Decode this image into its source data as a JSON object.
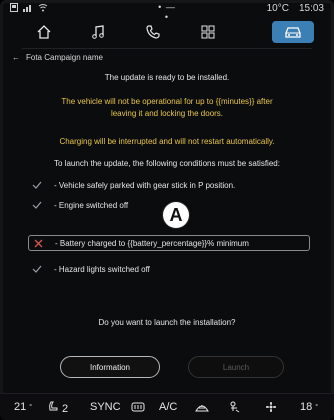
{
  "status_bar": {
    "left_icons": [
      "window-icon",
      "signal-icon",
      "wifi-icon"
    ],
    "center": "• — •",
    "temperature": "10°C",
    "time": "15:03"
  },
  "nav": {
    "items": [
      {
        "name": "home-icon"
      },
      {
        "name": "music-icon"
      },
      {
        "name": "phone-icon"
      },
      {
        "name": "apps-icon"
      },
      {
        "name": "car-icon",
        "active": true
      }
    ]
  },
  "breadcrumb": {
    "back_glyph": "←",
    "title": "Fota Campaign name"
  },
  "dialog": {
    "ready_text": "The update is ready to be installed.",
    "warning_line1": "The vehicle will not be operational for up to {{minutes}} after",
    "warning_line2": "leaving it and locking the doors.",
    "charging_text": "Charging will be interrupted and will not restart automatically.",
    "conditions_intro": "To launch the update, the following conditions must be satisfied:",
    "conditions": [
      {
        "label": "- Vehicle safely parked with gear stick in P position.",
        "status": "ok"
      },
      {
        "label": "- Engine switched off",
        "status": "ok"
      },
      {
        "label": "- Battery charged to {{battery_percentage}}% minimum",
        "status": "failed"
      },
      {
        "label": "- Hazard lights switched off",
        "status": "ok"
      }
    ],
    "marker": "A",
    "question": "Do you want to launch the installation?",
    "info_button": "Information",
    "launch_button": "Launch"
  },
  "bottom_bar": {
    "left_temp": "21",
    "left_temp_unit": "°",
    "seat_level": "2",
    "sync": "SYNC",
    "ac": "A/C",
    "right_temp": "18",
    "right_temp_unit": "°"
  },
  "colors": {
    "accent": "#3b7fb5",
    "warning_text": "#e8c64a",
    "ok_check": "#9aa0a6",
    "fail_x": "#d9534f"
  }
}
